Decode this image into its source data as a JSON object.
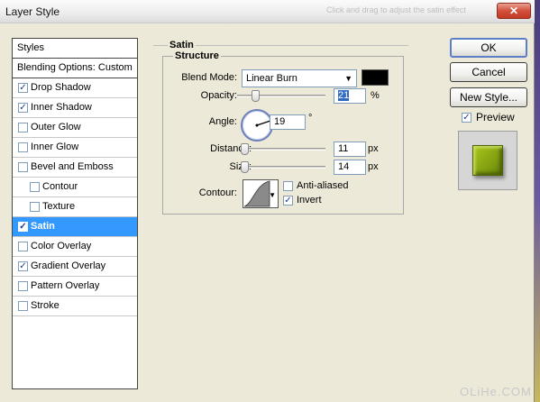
{
  "window": {
    "title": "Layer Style",
    "ghost_text": "Click and drag to adjust the satin effect",
    "close_glyph": "✕"
  },
  "styles_panel": {
    "header": "Styles",
    "blending_options": "Blending Options: Custom",
    "items": [
      {
        "label": "Drop Shadow",
        "checked": true,
        "sub": false,
        "selected": false
      },
      {
        "label": "Inner Shadow",
        "checked": true,
        "sub": false,
        "selected": false
      },
      {
        "label": "Outer Glow",
        "checked": false,
        "sub": false,
        "selected": false
      },
      {
        "label": "Inner Glow",
        "checked": false,
        "sub": false,
        "selected": false
      },
      {
        "label": "Bevel and Emboss",
        "checked": false,
        "sub": false,
        "selected": false
      },
      {
        "label": "Contour",
        "checked": false,
        "sub": true,
        "selected": false
      },
      {
        "label": "Texture",
        "checked": false,
        "sub": true,
        "selected": false
      },
      {
        "label": "Satin",
        "checked": true,
        "sub": false,
        "selected": true
      },
      {
        "label": "Color Overlay",
        "checked": false,
        "sub": false,
        "selected": false
      },
      {
        "label": "Gradient Overlay",
        "checked": true,
        "sub": false,
        "selected": false
      },
      {
        "label": "Pattern Overlay",
        "checked": false,
        "sub": false,
        "selected": false
      },
      {
        "label": "Stroke",
        "checked": false,
        "sub": false,
        "selected": false
      }
    ]
  },
  "satin": {
    "group_title": "Satin",
    "structure_title": "Structure",
    "blend_mode_label": "Blend Mode:",
    "blend_mode_value": "Linear Burn",
    "blend_color": "#000000",
    "opacity_label": "Opacity:",
    "opacity_value": "21",
    "opacity_unit": "%",
    "angle_label": "Angle:",
    "angle_value": "19",
    "angle_unit": "°",
    "distance_label": "Distance:",
    "distance_value": "11",
    "distance_unit": "px",
    "size_label": "Size:",
    "size_value": "14",
    "size_unit": "px",
    "contour_label": "Contour:",
    "anti_aliased_label": "Anti-aliased",
    "anti_aliased_checked": false,
    "invert_label": "Invert",
    "invert_checked": true
  },
  "buttons": {
    "ok": "OK",
    "cancel": "Cancel",
    "new_style": "New Style..."
  },
  "preview": {
    "label": "Preview",
    "checked": true,
    "swatch_color": "#8aa814"
  },
  "watermark": "OLiHe.COM"
}
